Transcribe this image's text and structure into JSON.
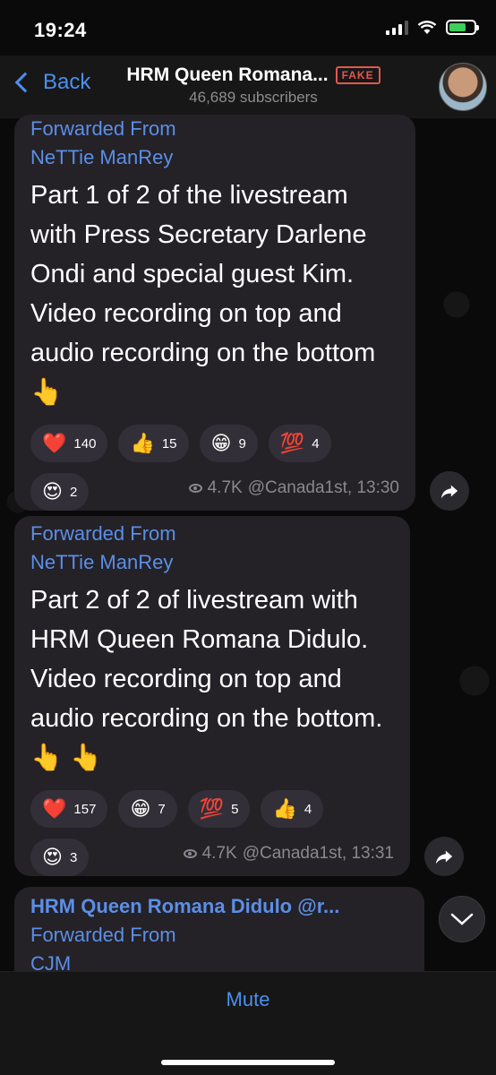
{
  "status_bar": {
    "time": "19:24"
  },
  "header": {
    "back_label": "Back",
    "title": "HRM Queen Romana...",
    "badge": "FAKE",
    "subscribers": "46,689 subscribers"
  },
  "messages": [
    {
      "forwarded_label": "Forwarded From",
      "forwarded_name": "NeTTie ManRey",
      "text": "Part 1 of 2 of the livestream with Press Secretary Darlene Ondi and special guest Kim. Video recording on top and audio recording on the bottom 👆",
      "reactions": [
        {
          "emoji": "❤️",
          "count": "140"
        },
        {
          "emoji": "👍",
          "count": "15"
        },
        {
          "emoji": "😁",
          "count": "9"
        },
        {
          "emoji": "💯",
          "count": "4"
        },
        {
          "emoji": "😍",
          "count": "2"
        }
      ],
      "views": "4.7K",
      "author": "@Canada1st, 13:30"
    },
    {
      "forwarded_label": "Forwarded From",
      "forwarded_name": "NeTTie ManRey",
      "text": "Part 2 of 2 of livestream with HRM Queen Romana Didulo. Video recording on top and audio recording on the bottom. 👆 👆",
      "reactions": [
        {
          "emoji": "❤️",
          "count": "157"
        },
        {
          "emoji": "😁",
          "count": "7"
        },
        {
          "emoji": "💯",
          "count": "5"
        },
        {
          "emoji": "👍",
          "count": "4"
        },
        {
          "emoji": "😍",
          "count": "3"
        }
      ],
      "views": "4.7K",
      "author": "@Canada1st, 13:31"
    },
    {
      "sender": "HRM Queen Romana Didulo @r...",
      "forwarded_label": "Forwarded From",
      "forwarded_name": "CJM"
    }
  ],
  "bottom": {
    "mute_label": "Mute"
  },
  "colors": {
    "accent": "#4a90f0",
    "fake_badge": "#e0584d",
    "bubble": "#242127"
  }
}
